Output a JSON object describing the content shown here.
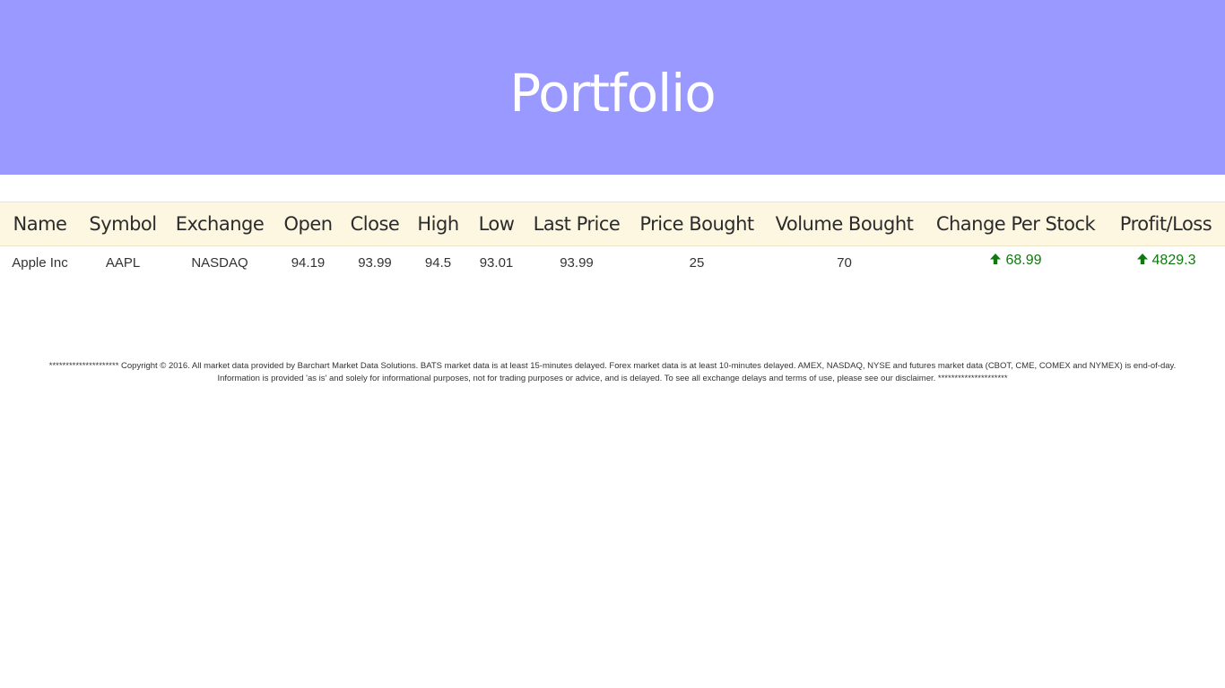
{
  "header": {
    "title": "Portfolio"
  },
  "table": {
    "columns": [
      "Name",
      "Symbol",
      "Exchange",
      "Open",
      "Close",
      "High",
      "Low",
      "Last Price",
      "Price Bought",
      "Volume Bought",
      "Change Per Stock",
      "Profit/Loss"
    ],
    "rows": [
      {
        "name": "Apple Inc",
        "symbol": "AAPL",
        "exchange": "NASDAQ",
        "open": "94.19",
        "close": "93.99",
        "high": "94.5",
        "low": "93.01",
        "last_price": "93.99",
        "price_bought": "25",
        "volume_bought": "70",
        "change_per_stock": "68.99",
        "profit_loss": "4829.3"
      }
    ]
  },
  "icons": {
    "change_direction": "arrow-up-icon",
    "profit_direction": "arrow-up-icon"
  },
  "colors": {
    "header_bg": "#9999ff",
    "table_header_bg": "#fdf7e2",
    "gain": "#0e7a0d"
  },
  "footer": {
    "line1": "********************* Copyright © 2016. All market data provided by Barchart Market Data Solutions. BATS market data is at least 15-minutes delayed. Forex market data is at least 10-minutes delayed. AMEX, NASDAQ, NYSE and futures market data (CBOT, CME, COMEX and NYMEX) is end-of-day.",
    "line2": "Information is provided 'as is' and solely for informational purposes, not for trading purposes or advice, and is delayed. To see all exchange delays and terms of use, please see our disclaimer. *********************"
  }
}
